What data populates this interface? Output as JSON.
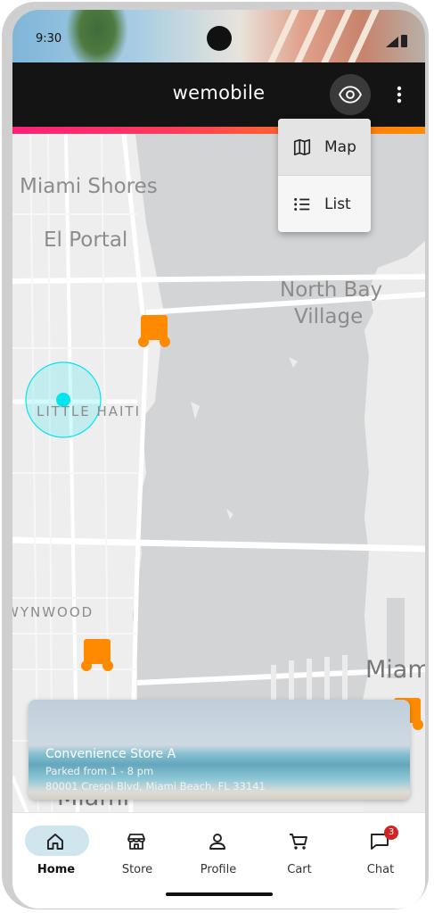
{
  "status_bar": {
    "time": "9:30"
  },
  "app_bar": {
    "title": "wemobile",
    "view_icon": "eye-icon",
    "more_icon": "more-vert-icon"
  },
  "view_menu": {
    "items": [
      {
        "label": "Map",
        "icon": "map-icon"
      },
      {
        "label": "List",
        "icon": "list-icon"
      }
    ]
  },
  "map": {
    "labels": {
      "miami_shores": "Miami Shores",
      "el_portal": "El Portal",
      "north_bay_1": "North Bay",
      "north_bay_2": "Village",
      "little_haiti": "LITTLE HAITI",
      "wynwood": "WYNWOOD",
      "miami_big": "Miam",
      "miami_bottom": "Miami"
    },
    "marker_icon": "truck-marker-icon",
    "location_color": "#00e5f0",
    "marker_color": "#ff8a00"
  },
  "store_card": {
    "name": "Convenience Store A",
    "hours": "Parked from 1 - 8 pm",
    "address": "80001 Crespi Blvd, Miami Beach, FL 33141"
  },
  "bottom_nav": {
    "items": [
      {
        "label": "Home",
        "icon": "home-icon",
        "active": true
      },
      {
        "label": "Store",
        "icon": "store-icon"
      },
      {
        "label": "Profile",
        "icon": "person-icon"
      },
      {
        "label": "Cart",
        "icon": "cart-icon"
      },
      {
        "label": "Chat",
        "icon": "chat-icon",
        "badge": "3"
      }
    ]
  },
  "colors": {
    "accent_gradient_start": "#ff1f7a",
    "accent_gradient_end": "#ff8c00",
    "app_bar": "#141414"
  }
}
